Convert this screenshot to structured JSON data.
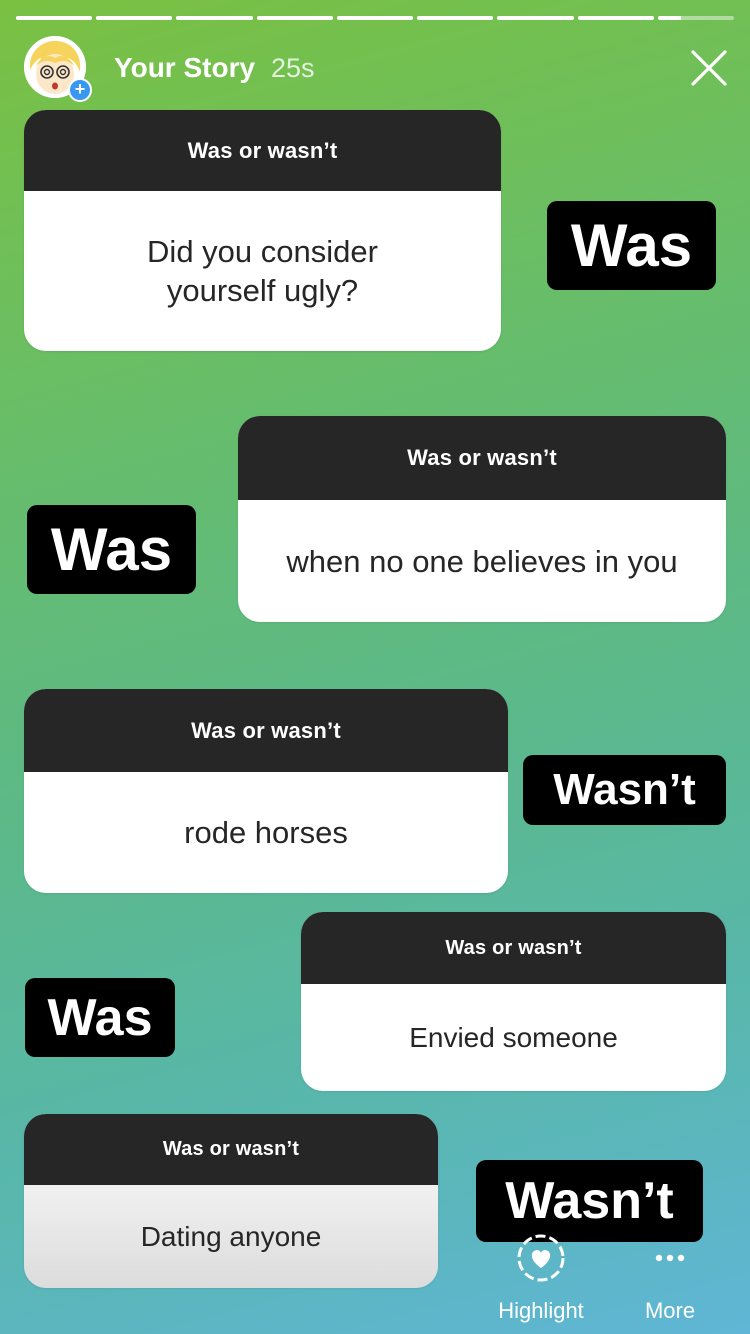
{
  "header": {
    "story_name": "Your Story",
    "elapsed": "25s",
    "progress": {
      "segments": 9,
      "filled": 8.3
    }
  },
  "stickers": [
    {
      "title": "Was or wasn’t",
      "question": "Did you consider yourself ugly?",
      "answer": "Was"
    },
    {
      "title": "Was or wasn’t",
      "question": "when no one believes in you",
      "answer": "Was"
    },
    {
      "title": "Was or wasn’t",
      "question": "rode horses",
      "answer": "Wasn’t"
    },
    {
      "title": "Was or wasn’t",
      "question": "Envied someone",
      "answer": "Was"
    },
    {
      "title": "Was or wasn’t",
      "question": "Dating anyone",
      "answer": "Wasn’t"
    }
  ],
  "footer": {
    "highlight_label": "Highlight",
    "more_label": "More"
  },
  "icons": {
    "close": "close-icon",
    "highlight": "heart-circle-icon",
    "more": "more-dots-icon",
    "add": "plus-badge-icon"
  },
  "colors": {
    "sticker_header": "#262626",
    "answer_bg": "#000000",
    "add_badge": "#3897f0"
  }
}
